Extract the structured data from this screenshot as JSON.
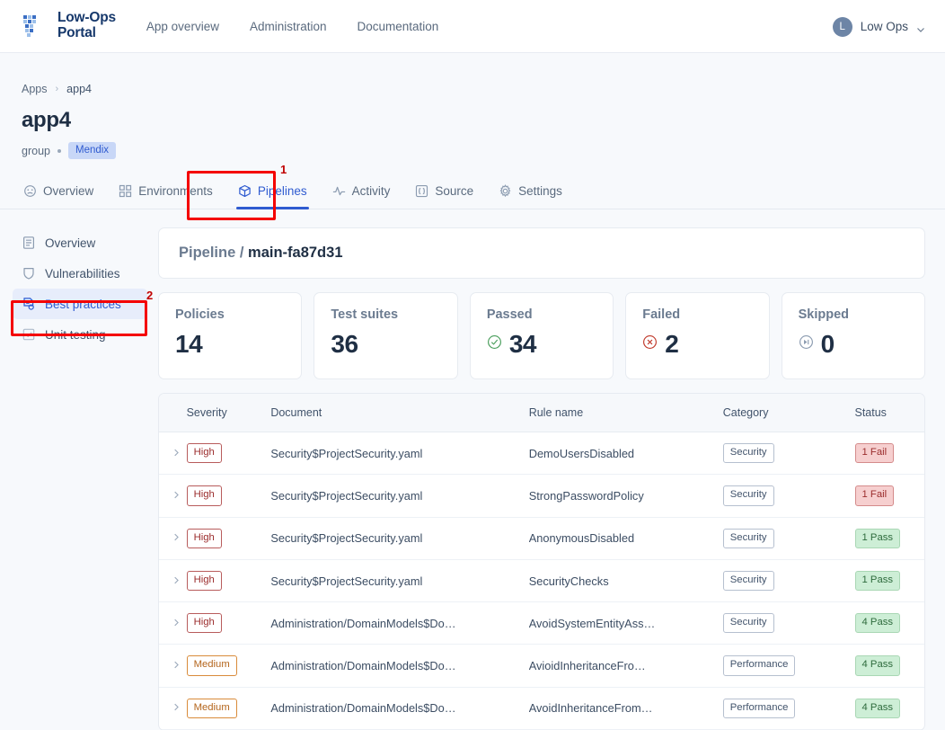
{
  "topbar": {
    "brand": {
      "name": "Low-Ops\nPortal",
      "logo_icon": "low-ops-logo-icon"
    },
    "nav": [
      {
        "label": "App overview"
      },
      {
        "label": "Administration"
      },
      {
        "label": "Documentation"
      }
    ],
    "user": {
      "initial": "L",
      "name": "Low Ops",
      "caret_icon": "chevron-down-icon"
    }
  },
  "breadcrumb": {
    "root": "Apps",
    "separator": "›",
    "current": "app4"
  },
  "page": {
    "title": "app4",
    "group_label": "group",
    "platform_chip": "Mendix"
  },
  "tabs": [
    {
      "label": "Overview",
      "icon": "gauge-icon",
      "active": false
    },
    {
      "label": "Environments",
      "icon": "grid-icon",
      "active": false
    },
    {
      "label": "Pipelines",
      "icon": "cube-icon",
      "active": true
    },
    {
      "label": "Activity",
      "icon": "pulse-icon",
      "active": false
    },
    {
      "label": "Source",
      "icon": "code-braces-icon",
      "active": false
    },
    {
      "label": "Settings",
      "icon": "gear-icon",
      "active": false
    }
  ],
  "sidenav": [
    {
      "label": "Overview",
      "icon": "document-icon",
      "active": false
    },
    {
      "label": "Vulnerabilities",
      "icon": "shield-icon",
      "active": false
    },
    {
      "label": "Best practices",
      "icon": "document-check-icon",
      "active": true
    },
    {
      "label": "Unit testing",
      "icon": "checkbox-icon",
      "active": false
    }
  ],
  "pipeline": {
    "prefix": "Pipeline /",
    "name": "main-fa87d31"
  },
  "stats": [
    {
      "label": "Policies",
      "value": "14",
      "icon": null,
      "icon_color": null
    },
    {
      "label": "Test suites",
      "value": "36",
      "icon": null,
      "icon_color": null
    },
    {
      "label": "Passed",
      "value": "34",
      "icon": "check-circle-icon",
      "icon_color": "#4a9e5c"
    },
    {
      "label": "Failed",
      "value": "2",
      "icon": "x-circle-icon",
      "icon_color": "#c0392b"
    },
    {
      "label": "Skipped",
      "value": "0",
      "icon": "skip-circle-icon",
      "icon_color": "#8b9bb0"
    }
  ],
  "table": {
    "columns": [
      "Severity",
      "Document",
      "Rule name",
      "Category",
      "Status"
    ],
    "expand_icon": "chevron-right-icon",
    "rows": [
      {
        "severity": "High",
        "severity_type": "high",
        "document": "Security$ProjectSecurity.yaml",
        "rule": "DemoUsersDisabled",
        "category": "Security",
        "status": "1 Fail",
        "status_type": "fail"
      },
      {
        "severity": "High",
        "severity_type": "high",
        "document": "Security$ProjectSecurity.yaml",
        "rule": "StrongPasswordPolicy",
        "category": "Security",
        "status": "1 Fail",
        "status_type": "fail"
      },
      {
        "severity": "High",
        "severity_type": "high",
        "document": "Security$ProjectSecurity.yaml",
        "rule": "AnonymousDisabled",
        "category": "Security",
        "status": "1 Pass",
        "status_type": "pass"
      },
      {
        "severity": "High",
        "severity_type": "high",
        "document": "Security$ProjectSecurity.yaml",
        "rule": "SecurityChecks",
        "category": "Security",
        "status": "1 Pass",
        "status_type": "pass"
      },
      {
        "severity": "High",
        "severity_type": "high",
        "document": "Administration/DomainModels$Do…",
        "rule": "AvoidSystemEntityAss…",
        "category": "Security",
        "status": "4 Pass",
        "status_type": "pass"
      },
      {
        "severity": "Medium",
        "severity_type": "medium",
        "document": "Administration/DomainModels$Do…",
        "rule": "AvioidInheritanceFro…",
        "category": "Performance",
        "status": "4 Pass",
        "status_type": "pass"
      },
      {
        "severity": "Medium",
        "severity_type": "medium",
        "document": "Administration/DomainModels$Do…",
        "rule": "AvoidInheritanceFrom…",
        "category": "Performance",
        "status": "4 Pass",
        "status_type": "pass"
      }
    ]
  },
  "annotations": [
    {
      "number": "1",
      "target": "tab-pipelines"
    },
    {
      "number": "2",
      "target": "sidebar-item-best-practices"
    }
  ],
  "colors": {
    "accent": "#2f5bd0",
    "pass": "#2e6b3d",
    "fail": "#9b2c2c",
    "high": "#9b2c2c",
    "medium": "#b4651c",
    "annotation": "#f40000"
  }
}
